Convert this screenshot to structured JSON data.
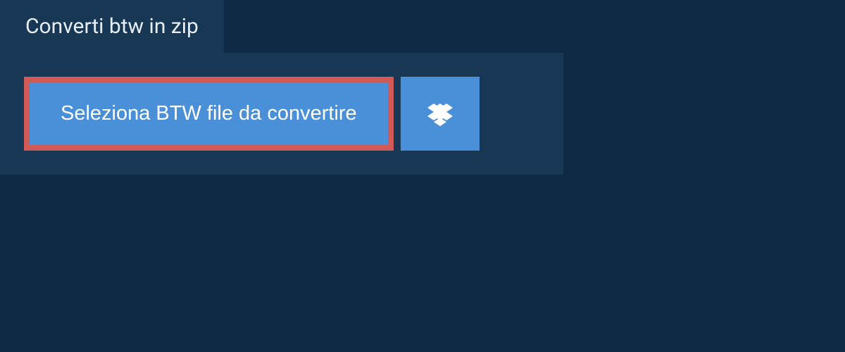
{
  "header": {
    "tab_label": "Converti btw in zip"
  },
  "actions": {
    "select_file_label": "Seleziona BTW file da convertire"
  },
  "colors": {
    "background": "#0f2a44",
    "panel": "#173755",
    "button": "#4a90d9",
    "highlight_border": "#d25a56"
  },
  "icons": {
    "dropbox": "dropbox-icon"
  }
}
